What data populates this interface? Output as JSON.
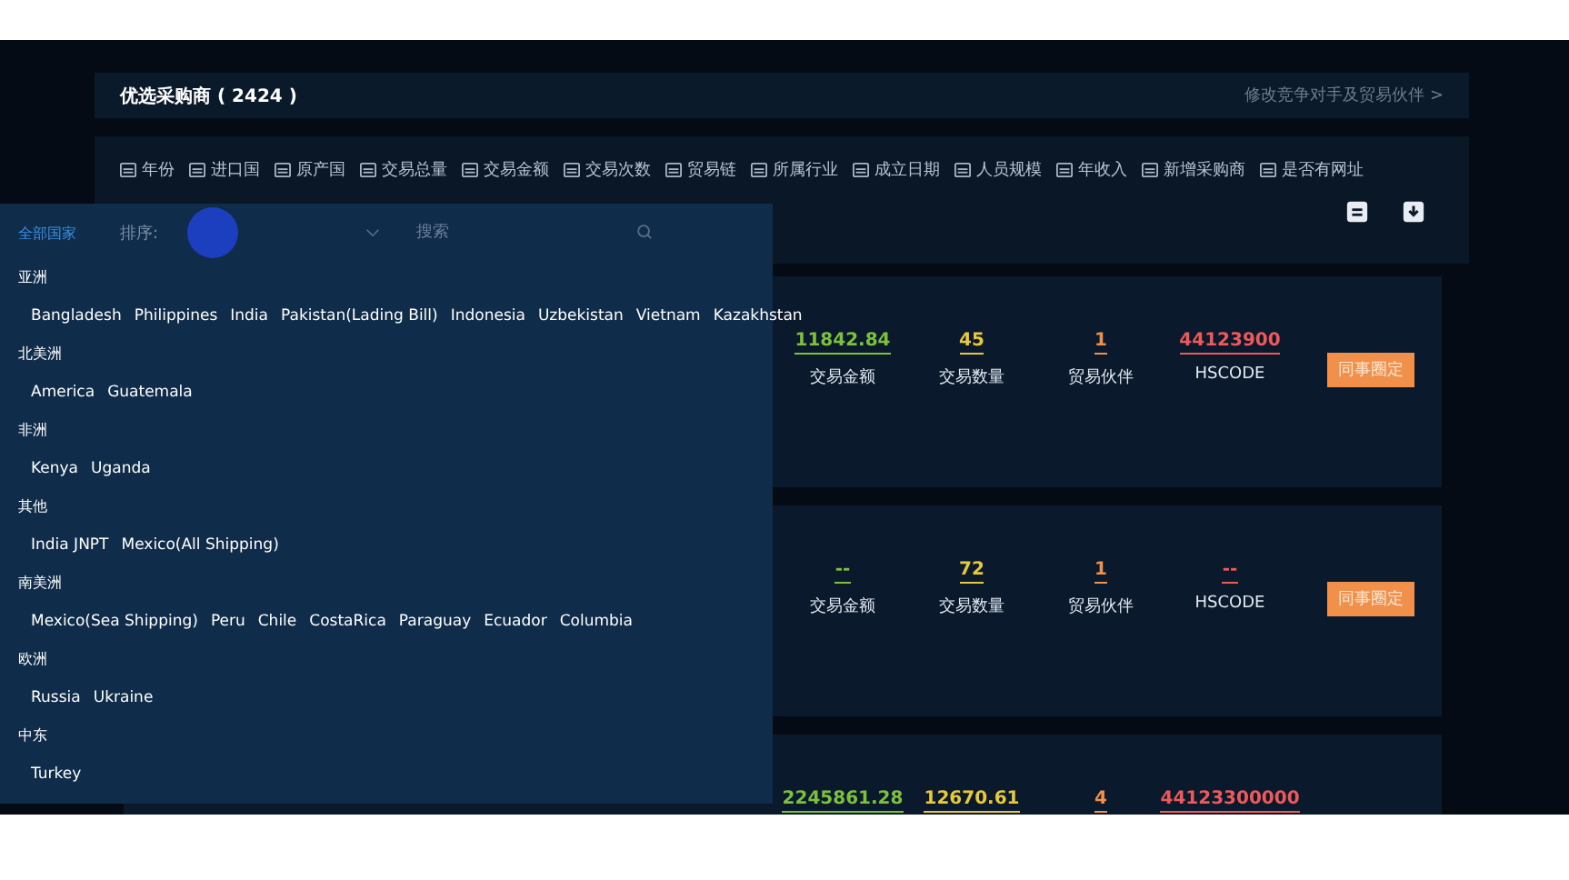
{
  "header": {
    "title": "优选采购商 ( 2424 )",
    "link": "修改竞争对手及贸易伙伴 >"
  },
  "filters": [
    "年份",
    "进口国",
    "原产国",
    "交易总量",
    "交易金额",
    "交易次数",
    "贸易链",
    "所属行业",
    "成立日期",
    "人员规模",
    "年收入",
    "新增采购商",
    "是否有网址"
  ],
  "sort": {
    "label": "排序:",
    "search_placeholder": "搜索"
  },
  "countries": {
    "all": {
      "label": "全部国家",
      "selected": true
    },
    "groups": [
      {
        "name": "亚洲",
        "items": [
          "Bangladesh",
          "Philippines",
          "India",
          "Pakistan(Lading Bill)",
          "Indonesia",
          "Uzbekistan",
          "Vietnam",
          "Kazakhstan"
        ]
      },
      {
        "name": "北美洲",
        "items": [
          "America",
          "Guatemala"
        ]
      },
      {
        "name": "非洲",
        "items": [
          "Kenya",
          "Uganda"
        ]
      },
      {
        "name": "其他",
        "items": [
          "India JNPT",
          "Mexico(All Shipping)"
        ]
      },
      {
        "name": "南美洲",
        "items": [
          "Mexico(Sea Shipping)",
          "Peru",
          "Chile",
          "CostaRica",
          "Paraguay",
          "Ecuador",
          "Columbia"
        ]
      },
      {
        "name": "欧洲",
        "items": [
          "Russia",
          "Ukraine"
        ]
      },
      {
        "name": "中东",
        "items": [
          "Turkey"
        ]
      }
    ]
  },
  "cards": [
    {
      "stats": [
        {
          "value": "11842.84",
          "label": "交易金额",
          "color": "#7cc13a"
        },
        {
          "value": "45",
          "label": "交易数量",
          "color": "#e8c93a"
        },
        {
          "value": "1",
          "label": "贸易伙伴",
          "color": "#f0904a"
        },
        {
          "value": "44123900",
          "label": "HSCODE",
          "color": "#f0585a"
        }
      ],
      "button": "同事圈定"
    },
    {
      "stats": [
        {
          "value": "--",
          "label": "交易金额",
          "color": "#7cc13a"
        },
        {
          "value": "72",
          "label": "交易数量",
          "color": "#e8c93a"
        },
        {
          "value": "1",
          "label": "贸易伙伴",
          "color": "#f0904a"
        },
        {
          "value": "--",
          "label": "HSCODE",
          "color": "#f0585a"
        }
      ],
      "button": "同事圈定"
    },
    {
      "stats": [
        {
          "value": "2245861.28",
          "color": "#7cc13a"
        },
        {
          "value": "12670.61",
          "color": "#e8c93a"
        },
        {
          "value": "4",
          "color": "#f0904a"
        },
        {
          "value": "44123300000",
          "color": "#f0585a"
        }
      ]
    }
  ]
}
